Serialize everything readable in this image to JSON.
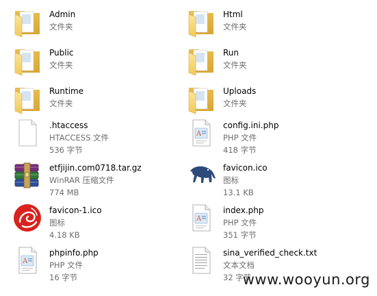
{
  "folders": {
    "admin": {
      "name": "Admin",
      "type": "文件夹"
    },
    "html": {
      "name": "Html",
      "type": "文件夹"
    },
    "public": {
      "name": "Public",
      "type": "文件夹"
    },
    "run": {
      "name": "Run",
      "type": "文件夹"
    },
    "runtime": {
      "name": "Runtime",
      "type": "文件夹"
    },
    "uploads": {
      "name": "Uploads",
      "type": "文件夹"
    }
  },
  "files": {
    "htaccess": {
      "name": ".htaccess",
      "type": "HTACCESS 文件",
      "size": "536 字节"
    },
    "config": {
      "name": "config.ini.php",
      "type": "PHP 文件",
      "size": "418 字节"
    },
    "archive": {
      "name": "etfjijin.com0718.tar.gz",
      "type": "WinRAR 压缩文件",
      "size": "774 MB"
    },
    "favicon": {
      "name": "favicon.ico",
      "type": "图标",
      "size": "13.1 KB"
    },
    "favicon1": {
      "name": "favicon-1.ico",
      "type": "图标",
      "size": "4.18 KB"
    },
    "index": {
      "name": "index.php",
      "type": "PHP 文件",
      "size": "351 字节"
    },
    "phpinfo": {
      "name": "phpinfo.php",
      "type": "PHP 文件",
      "size": "16 字节"
    },
    "sina": {
      "name": "sina_verified_check.txt",
      "type": "文本文档",
      "size": "32 字节"
    }
  },
  "icons": {
    "folder": "folder-icon",
    "php": "php-file-icon",
    "generic": "generic-file-icon",
    "rar": "winrar-archive-icon",
    "ico_elephant": "elephant-icon",
    "ico_red": "red-emblem-icon",
    "txt": "text-document-icon"
  },
  "colors": {
    "folder_front": "#f6d675",
    "folder_back": "#e4b33f",
    "secondary_text": "#6d6d6d"
  },
  "watermark": "www.wooyun.org"
}
